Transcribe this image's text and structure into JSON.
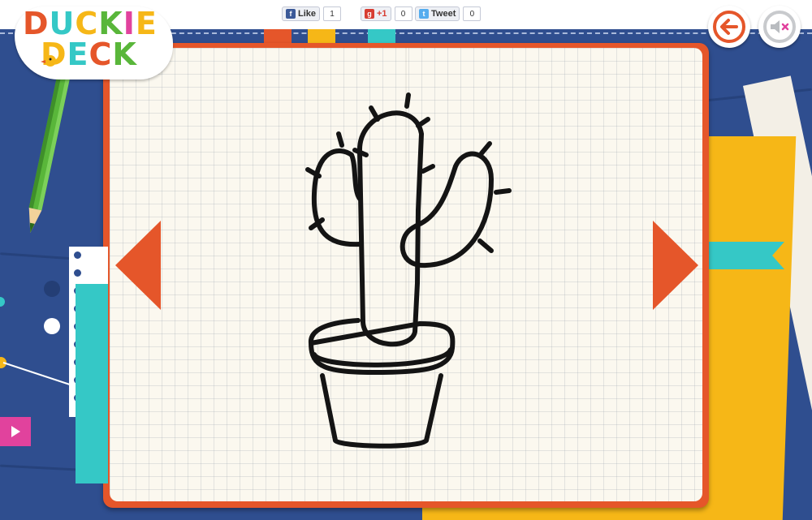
{
  "brand": {
    "logo_line1": "DUCKIE",
    "logo_line2": "DECK"
  },
  "social": {
    "facebook": {
      "label": "Like",
      "count": "1"
    },
    "google": {
      "label": "+1",
      "count": "0"
    },
    "twitter": {
      "label": "Tweet",
      "count": "0"
    }
  },
  "controls": {
    "back_icon": "arrow-left-icon",
    "sound_icon": "speaker-muted-icon",
    "prev_icon": "triangle-left-icon",
    "next_icon": "triangle-right-icon",
    "play_icon": "play-icon"
  },
  "drawing": {
    "subject": "cactus-in-pot-icon"
  },
  "colors": {
    "desk_blue": "#2f4e8f",
    "notebook_orange": "#e5562a",
    "teal": "#35c8c6",
    "yellow": "#f6b717",
    "pink": "#e1429d",
    "pencil_green": "#59b63a",
    "paper": "#fbf8ef"
  }
}
